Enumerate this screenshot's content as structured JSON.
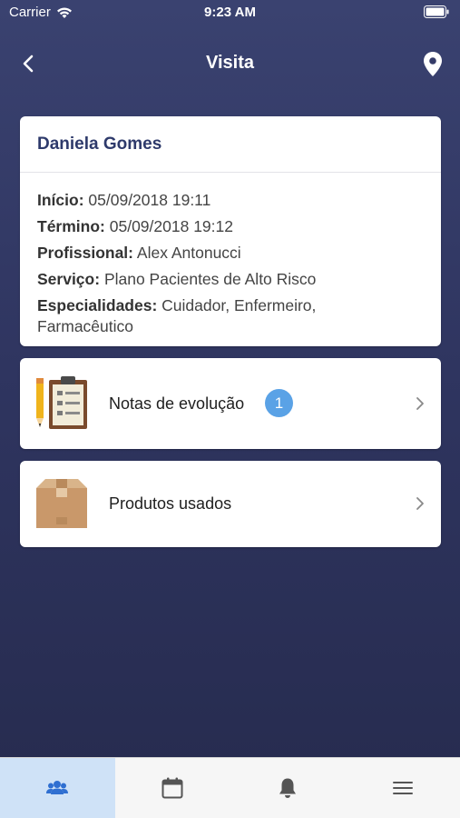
{
  "status_bar": {
    "carrier": "Carrier",
    "time": "9:23 AM"
  },
  "nav": {
    "title": "Visita",
    "back_icon": "chevron-left-icon",
    "location_icon": "map-pin-icon"
  },
  "visit": {
    "patient_name": "Daniela Gomes",
    "fields": [
      {
        "label": "Início:",
        "value": "05/09/2018 19:11"
      },
      {
        "label": "Término:",
        "value": "05/09/2018 19:12"
      },
      {
        "label": "Profissional:",
        "value": "Alex Antonucci"
      },
      {
        "label": "Serviço:",
        "value": "Plano Pacientes de Alto Risco"
      },
      {
        "label": "Especialidades:",
        "value": "Cuidador, Enfermeiro,",
        "value_cont": "Farmacêutico"
      }
    ]
  },
  "menu": {
    "notes": {
      "label": "Notas de evolução",
      "badge": "1",
      "icon": "clipboard-pencil-icon"
    },
    "products": {
      "label": "Produtos usados",
      "icon": "package-box-icon"
    }
  },
  "tab_bar": {
    "tabs": [
      {
        "icon": "users-icon",
        "active": true
      },
      {
        "icon": "calendar-icon",
        "active": false
      },
      {
        "icon": "bell-icon",
        "active": false
      },
      {
        "icon": "menu-icon",
        "active": false
      }
    ]
  },
  "colors": {
    "background_top": "#3a4270",
    "background_bottom": "#262b4e",
    "patient_name": "#2e3a6b",
    "badge": "#5aa2e6",
    "active_tab": "#cfe2f7",
    "tab_icon_active": "#2f6fd1",
    "tab_icon": "#555555"
  }
}
